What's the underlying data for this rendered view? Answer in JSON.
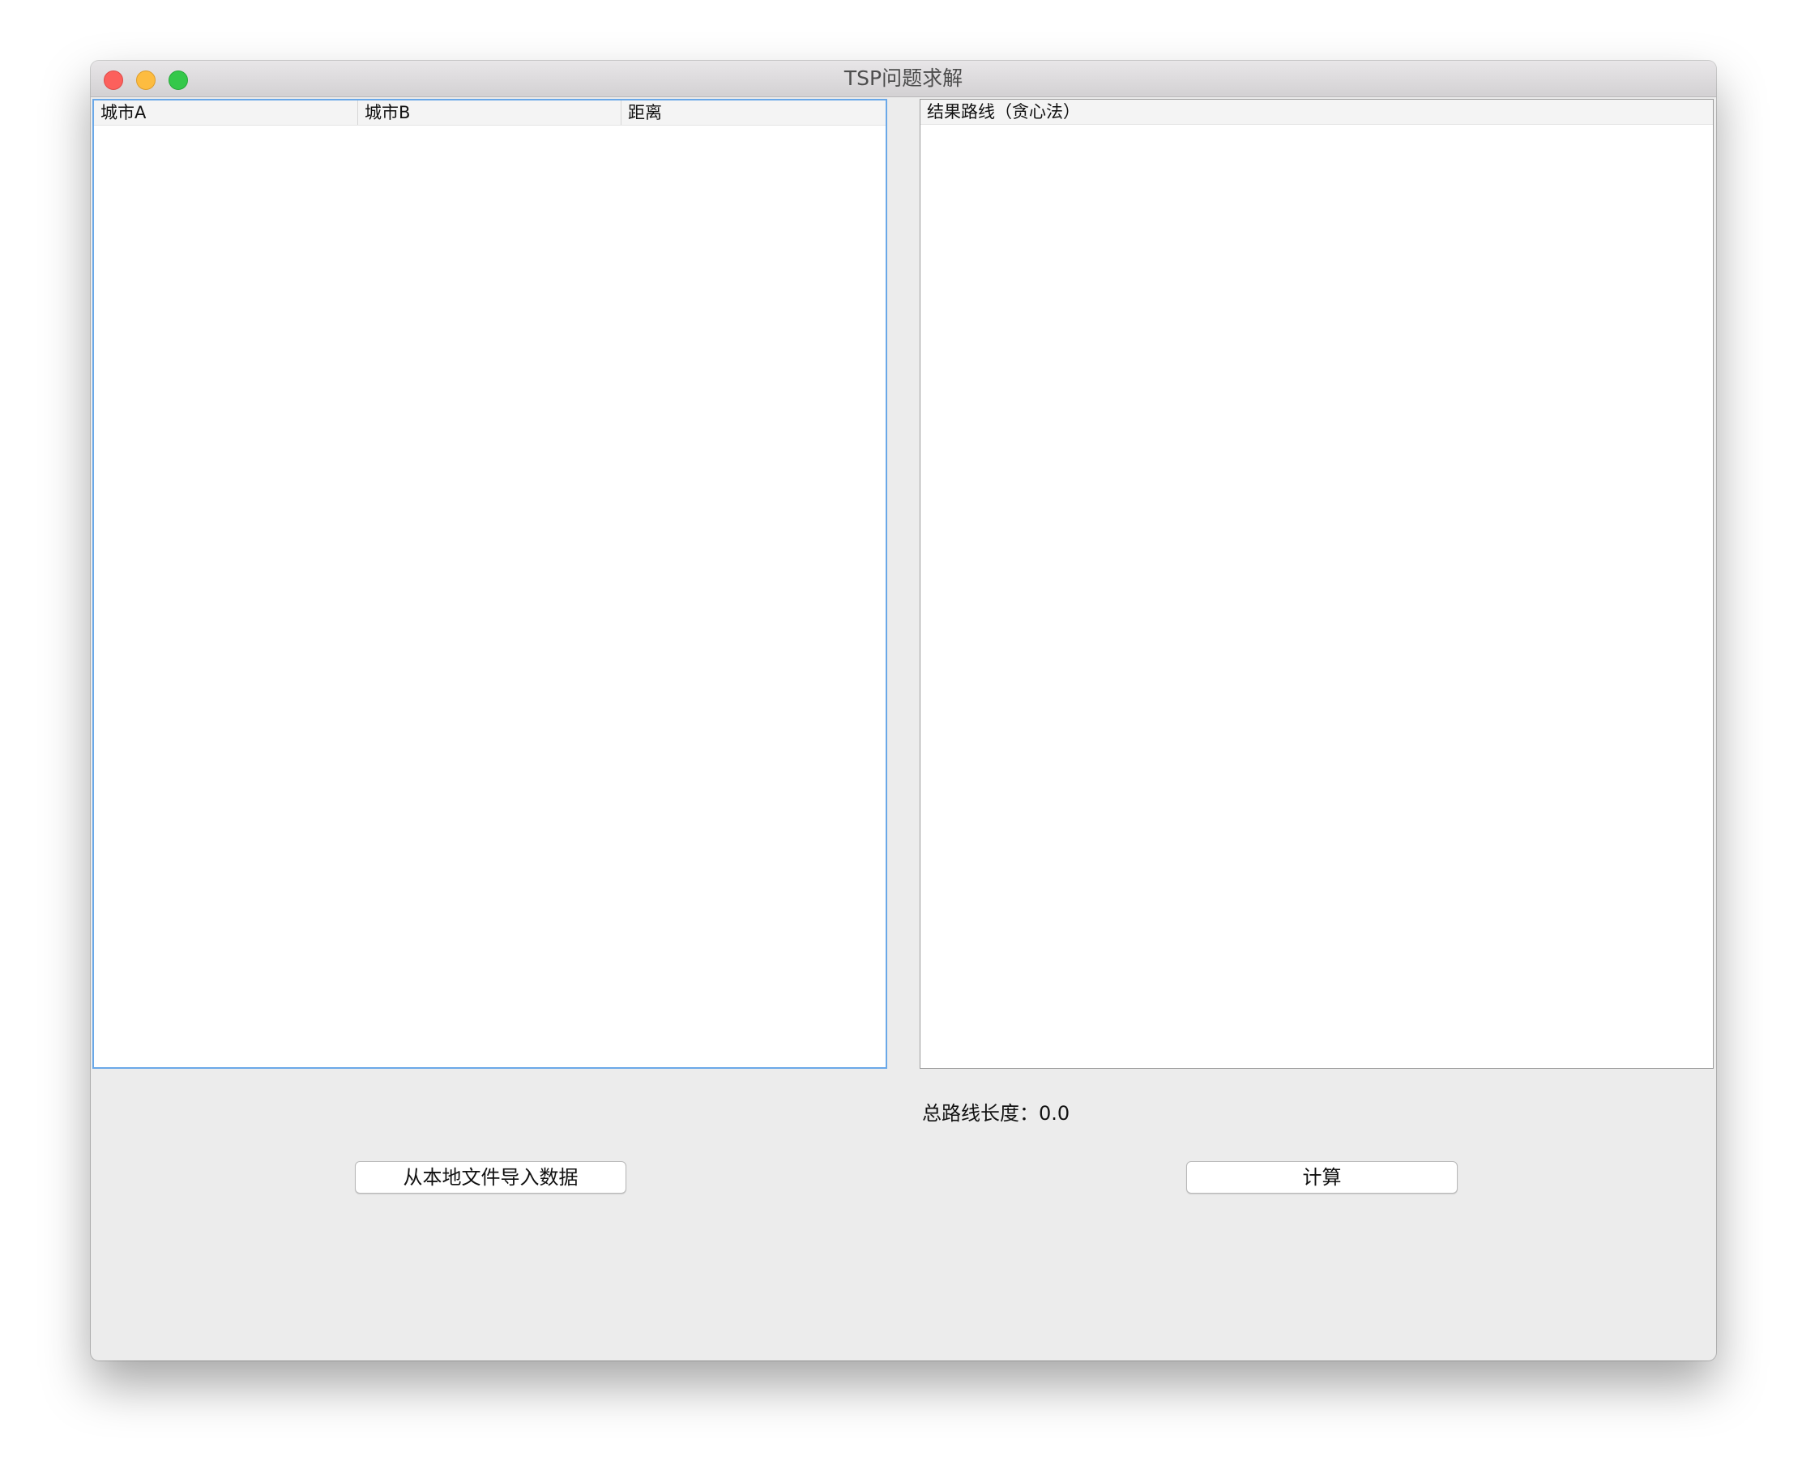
{
  "window": {
    "title": "TSP问题求解"
  },
  "input_table": {
    "columns": [
      "城市A",
      "城市B",
      "距离"
    ],
    "rows": []
  },
  "result_table": {
    "columns": [
      "结果路线（贪心法）"
    ],
    "rows": []
  },
  "summary": {
    "total_label": "总路线长度：",
    "total_value": "0.0"
  },
  "buttons": {
    "import_label": "从本地文件导入数据",
    "calculate_label": "计算"
  },
  "colors": {
    "window_bg": "#ececec",
    "focus_border": "#6aa8e8",
    "close": "#fc605c",
    "minimize": "#fdbc40",
    "maximize": "#34c84a"
  },
  "icons": [
    "close-icon",
    "minimize-icon",
    "maximize-icon"
  ]
}
